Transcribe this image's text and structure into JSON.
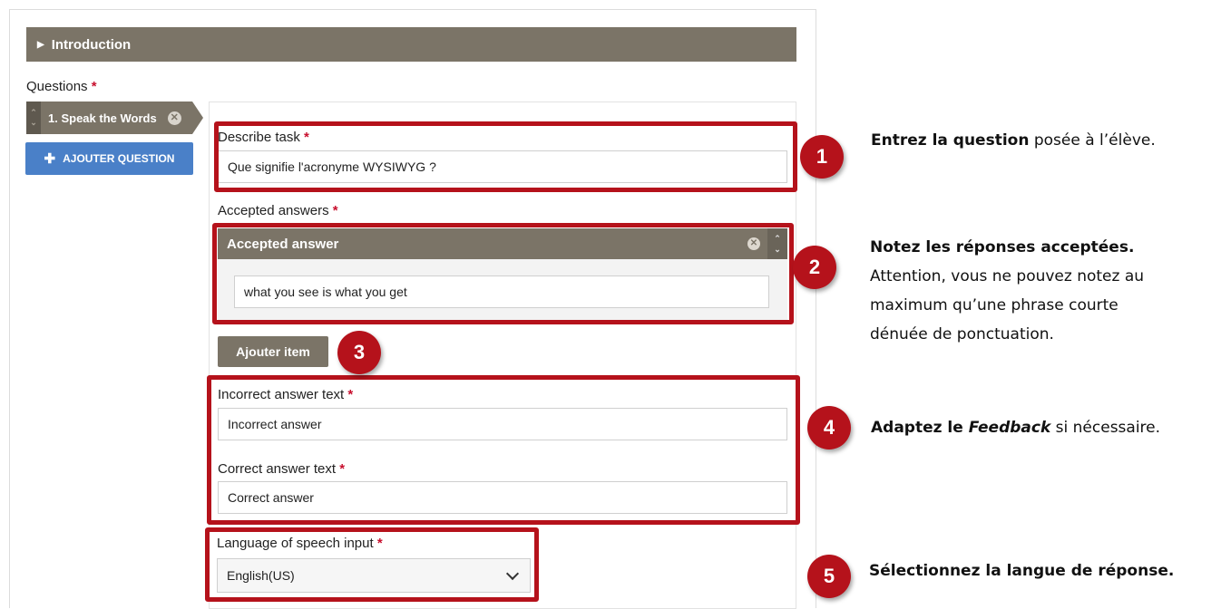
{
  "intro_section": {
    "label": "Introduction"
  },
  "questions": {
    "label": "Questions",
    "required_mark": "*",
    "tabs": [
      {
        "label": "1. Speak the Words"
      }
    ],
    "add_button": "AJOUTER QUESTION"
  },
  "form": {
    "describe_task": {
      "label": "Describe task",
      "required_mark": "*",
      "value": "Que signifie l'acronyme WYSIWYG ?"
    },
    "accepted_answers": {
      "label": "Accepted answers",
      "required_mark": "*",
      "items": [
        {
          "title": "Accepted answer",
          "value": "what you see is what you get"
        }
      ],
      "add_item_button": "Ajouter item"
    },
    "incorrect_answer_text": {
      "label": "Incorrect answer text",
      "required_mark": "*",
      "value": "Incorrect answer"
    },
    "correct_answer_text": {
      "label": "Correct answer text",
      "required_mark": "*",
      "value": "Correct answer"
    },
    "language": {
      "label": "Language of speech input",
      "required_mark": "*",
      "selected": "English(US)"
    }
  },
  "annotations": [
    {
      "number": "1",
      "bold": "Entrez la question",
      "text": " posée à l’élève."
    },
    {
      "number": "2",
      "bold": "Notez les réponses acceptées.",
      "lines": [
        "Attention, vous ne pouvez notez au",
        "maximum qu’une phrase courte",
        "dénuée de ponctuation."
      ]
    },
    {
      "number": "3"
    },
    {
      "number": "4",
      "bold": "Adaptez le ",
      "bold_italic": "Feedback",
      "text": " si nécessaire."
    },
    {
      "number": "5",
      "bold": "Sélectionnez la langue de réponse."
    }
  ],
  "colors": {
    "highlight": "#b5121b",
    "header_bar": "#7b7467",
    "primary_button": "#4a80c8",
    "required": "#c8102e"
  }
}
